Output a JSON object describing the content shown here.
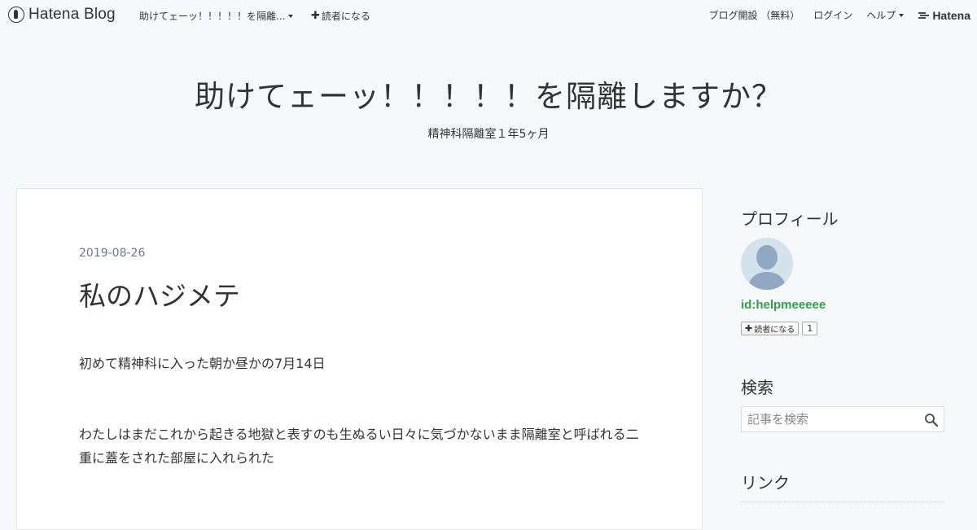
{
  "topbar": {
    "logo_text": "Hatena Blog",
    "blog_menu": "助けてェーッ！！！！！を隔離...",
    "subscribe": "読者になる",
    "open_blog": "ブログ開設 （無料）",
    "login": "ログイン",
    "help": "ヘルプ",
    "hatena": "Hatena"
  },
  "header": {
    "title": "助けてェーッ！！！！！を隔離しますか？",
    "description": "精神科隔離室１年5ヶ月"
  },
  "entry": {
    "date": "2019-08-26",
    "title": "私のハジメテ",
    "paragraphs": [
      "初めて精神科に入った朝か昼かの7月14日",
      "わたしはまだこれから起きる地獄と表すのも生ぬるい日々に気づかないまま隔離室と呼ばれる二重に蓋をされた部屋に入れられた"
    ]
  },
  "sidebar": {
    "profile_heading": "プロフィール",
    "profile_id": "id:helpmeeeee",
    "subscribe_button": "読者になる",
    "subscriber_count": "1",
    "search_heading": "検索",
    "search_placeholder": "記事を検索",
    "links_heading": "リンク"
  },
  "colors": {
    "background": "#f7f8f9",
    "profile_id": "#2ea24a",
    "date": "#6a7b86"
  }
}
